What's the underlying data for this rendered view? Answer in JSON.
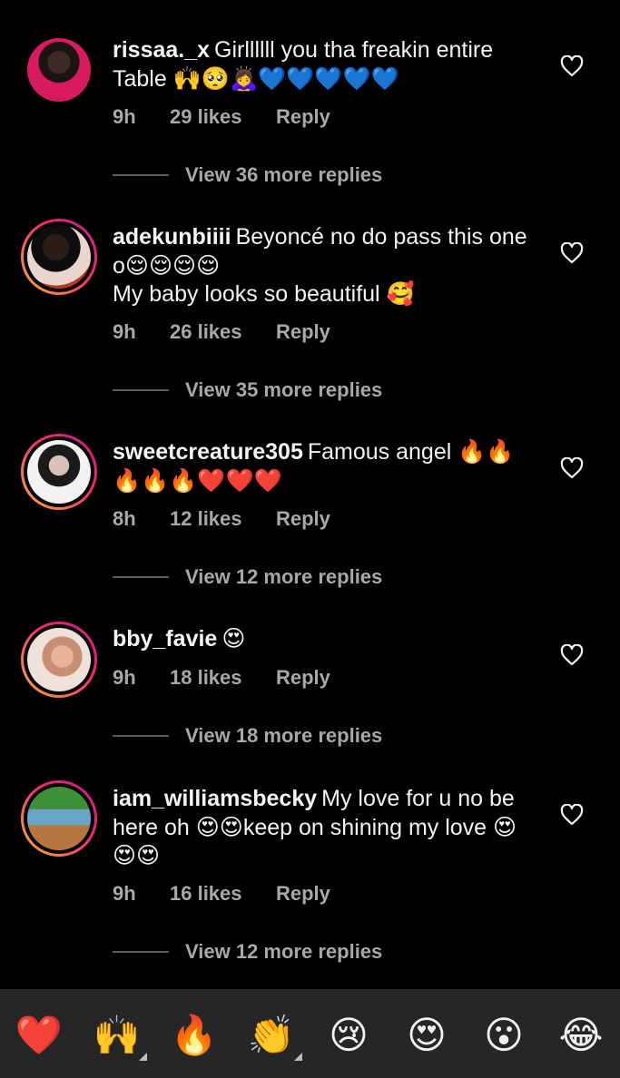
{
  "comments": [
    {
      "username": "rissaa._x",
      "text": "Girllllll you tha freakin entire Table 🙌🥺🙇‍♀️💙💙💙💙💙",
      "time": "9h",
      "likes": "29 likes",
      "reply": "Reply",
      "view_replies": "View 36 more replies"
    },
    {
      "username": "adekunbiiii",
      "text": "Beyoncé no do pass this one o😌😌😌😌",
      "text2": "My baby looks so beautiful 🥰",
      "time": "9h",
      "likes": "26 likes",
      "reply": "Reply",
      "view_replies": "View 35 more replies"
    },
    {
      "username": "sweetcreature305",
      "text": "Famous angel 🔥🔥🔥🔥🔥❤️❤️❤️",
      "time": "8h",
      "likes": "12 likes",
      "reply": "Reply",
      "view_replies": "View 12 more replies"
    },
    {
      "username": "bby_favie",
      "text": "😍",
      "time": "9h",
      "likes": "18 likes",
      "reply": "Reply",
      "view_replies": "View 18 more replies"
    },
    {
      "username": "iam_williamsbecky",
      "text": "My love for u no be here oh 😍😍keep on shining my love 😍😍😍",
      "time": "9h",
      "likes": "16 likes",
      "reply": "Reply",
      "view_replies": "View 12 more replies"
    }
  ],
  "emoji_bar": [
    "❤️",
    "🙌",
    "🔥",
    "👏",
    "😢",
    "😍",
    "😮",
    "😂"
  ],
  "colors": {
    "background": "#000000",
    "meta": "#a8a8a8",
    "emoji_bar": "#262626"
  }
}
